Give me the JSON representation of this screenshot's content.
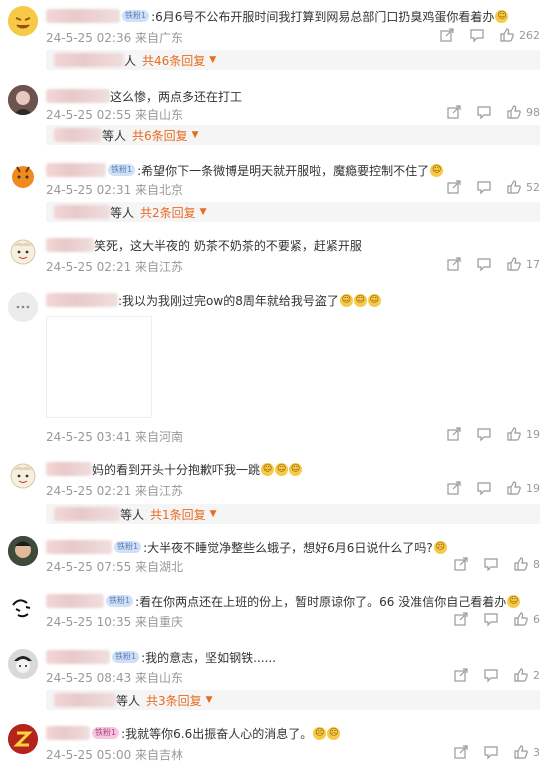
{
  "comments": [
    {
      "badge": "铁粉1",
      "text": ":6月6号不公布开服时间我打算到网易总部门口扔臭鸡蛋你看着办",
      "meta": "24-5-25 02:36 来自广东",
      "likes": "262",
      "reply_prefix": "人",
      "reply_more": "共46条回复"
    },
    {
      "badge": "",
      "text": "这么惨，两点多还在打工",
      "meta": "24-5-25 02:55 来自山东",
      "likes": "98",
      "reply_prefix": "等人",
      "reply_more": "共6条回复"
    },
    {
      "badge": "铁粉1",
      "text": ":希望你下一条微博是明天就开服啦，魔瘾要控制不住了",
      "meta": "24-5-25 02:31 来自北京",
      "likes": "52",
      "reply_prefix": "等人",
      "reply_more": "共2条回复"
    },
    {
      "badge": "",
      "text": "笑死，这大半夜的  奶茶不奶茶的不要紧，赶紧开服",
      "meta": "24-5-25 02:21 来自江苏",
      "likes": "17"
    },
    {
      "badge": "",
      "text": ":我以为我刚过完ow的8周年就给我号盗了",
      "meta": "24-5-25 03:41 来自河南",
      "likes": "19"
    },
    {
      "badge": "",
      "text": "妈的看到开头十分抱歉吓我一跳",
      "meta": "24-5-25 02:21 来自江苏",
      "likes": "19",
      "reply_prefix": "等人",
      "reply_more": "共1条回复"
    },
    {
      "badge": "铁粉1",
      "text": ":大半夜不睡觉净整些么蛾子，想好6月6日说什么了吗?",
      "meta": "24-5-25 07:55 来自湖北",
      "likes": "8"
    },
    {
      "badge": "铁粉1",
      "text": ":看在你两点还在上班的份上，暂时原谅你了。66 没准信你自己看着办",
      "meta": "24-5-25 10:35 来自重庆",
      "likes": "6"
    },
    {
      "badge": "铁粉1",
      "text": ":我的意志，坚如钢铁......",
      "meta": "24-5-25 08:43 来自山东",
      "likes": "2",
      "reply_prefix": "等人",
      "reply_more": "共3条回复"
    },
    {
      "badge": "铁粉1",
      "text": ":我就等你6.6出振奋人心的消息了。",
      "meta": "24-5-25 05:00 来自吉林",
      "likes": "3"
    }
  ],
  "icons": {
    "share": "share-icon",
    "comment": "comment-icon",
    "like": "thumbs-up-icon"
  },
  "colors": {
    "accent": "#e86b21",
    "meta": "#999999",
    "badge": "#cfe0f7"
  }
}
